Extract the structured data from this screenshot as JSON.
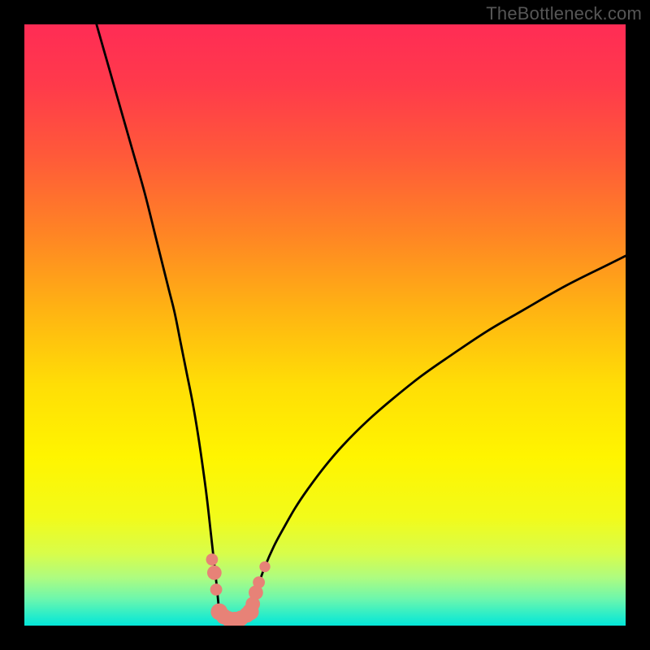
{
  "watermark": {
    "text": "TheBottleneck.com"
  },
  "colors": {
    "black": "#000000",
    "curve": "#000000",
    "marker": "#e78277",
    "gradient_stops": [
      {
        "offset": 0.0,
        "color": "#ff2c55"
      },
      {
        "offset": 0.1,
        "color": "#ff3a4b"
      },
      {
        "offset": 0.22,
        "color": "#ff5a39"
      },
      {
        "offset": 0.35,
        "color": "#ff8524"
      },
      {
        "offset": 0.48,
        "color": "#ffb512"
      },
      {
        "offset": 0.6,
        "color": "#ffde06"
      },
      {
        "offset": 0.72,
        "color": "#fff500"
      },
      {
        "offset": 0.82,
        "color": "#f2fb1a"
      },
      {
        "offset": 0.88,
        "color": "#d8fd4a"
      },
      {
        "offset": 0.92,
        "color": "#aefc80"
      },
      {
        "offset": 0.955,
        "color": "#6ef7ac"
      },
      {
        "offset": 0.985,
        "color": "#24eccb"
      },
      {
        "offset": 1.0,
        "color": "#04e6d8"
      }
    ]
  },
  "chart_data": {
    "type": "line",
    "title": "",
    "xlabel": "",
    "ylabel": "",
    "xlim": [
      0,
      100
    ],
    "ylim": [
      0,
      100
    ],
    "series": [
      {
        "name": "left-branch",
        "x": [
          12,
          14,
          16,
          18,
          20,
          22,
          24,
          25,
          26,
          27,
          28,
          29,
          30,
          30.5,
          31,
          31.5,
          32,
          32.4
        ],
        "values": [
          100,
          93,
          86,
          79,
          72,
          64,
          56,
          52,
          47,
          42,
          37,
          31,
          24,
          20,
          15.5,
          11,
          6.5,
          2.3
        ]
      },
      {
        "name": "right-branch",
        "x": [
          37.6,
          38.2,
          39,
          40,
          41.5,
          43,
          45,
          47,
          50,
          53,
          57,
          61,
          66,
          71,
          77,
          83,
          90,
          97,
          100
        ],
        "values": [
          2.3,
          4.5,
          7.0,
          9.8,
          13.2,
          16.0,
          19.5,
          22.5,
          26.5,
          30.0,
          34.0,
          37.5,
          41.5,
          45.0,
          49.0,
          52.5,
          56.5,
          60.0,
          61.5
        ]
      },
      {
        "name": "valley-floor",
        "x": [
          32.4,
          33.5,
          35,
          36.5,
          37.6
        ],
        "values": [
          2.3,
          1.3,
          1.0,
          1.3,
          2.3
        ]
      }
    ],
    "markers": [
      {
        "x": 31.2,
        "y": 11.0,
        "r": 1.0
      },
      {
        "x": 31.6,
        "y": 8.8,
        "r": 1.2
      },
      {
        "x": 31.9,
        "y": 6.0,
        "r": 1.0
      },
      {
        "x": 32.4,
        "y": 2.3,
        "r": 1.4
      },
      {
        "x": 33.2,
        "y": 1.5,
        "r": 1.3
      },
      {
        "x": 34.0,
        "y": 1.1,
        "r": 1.3
      },
      {
        "x": 35.0,
        "y": 1.0,
        "r": 1.3
      },
      {
        "x": 36.0,
        "y": 1.2,
        "r": 1.3
      },
      {
        "x": 37.0,
        "y": 1.8,
        "r": 1.3
      },
      {
        "x": 37.6,
        "y": 2.3,
        "r": 1.4
      },
      {
        "x": 38.0,
        "y": 3.6,
        "r": 1.2
      },
      {
        "x": 38.5,
        "y": 5.5,
        "r": 1.2
      },
      {
        "x": 39.0,
        "y": 7.2,
        "r": 1.0
      },
      {
        "x": 40.0,
        "y": 9.8,
        "r": 0.9
      }
    ]
  }
}
